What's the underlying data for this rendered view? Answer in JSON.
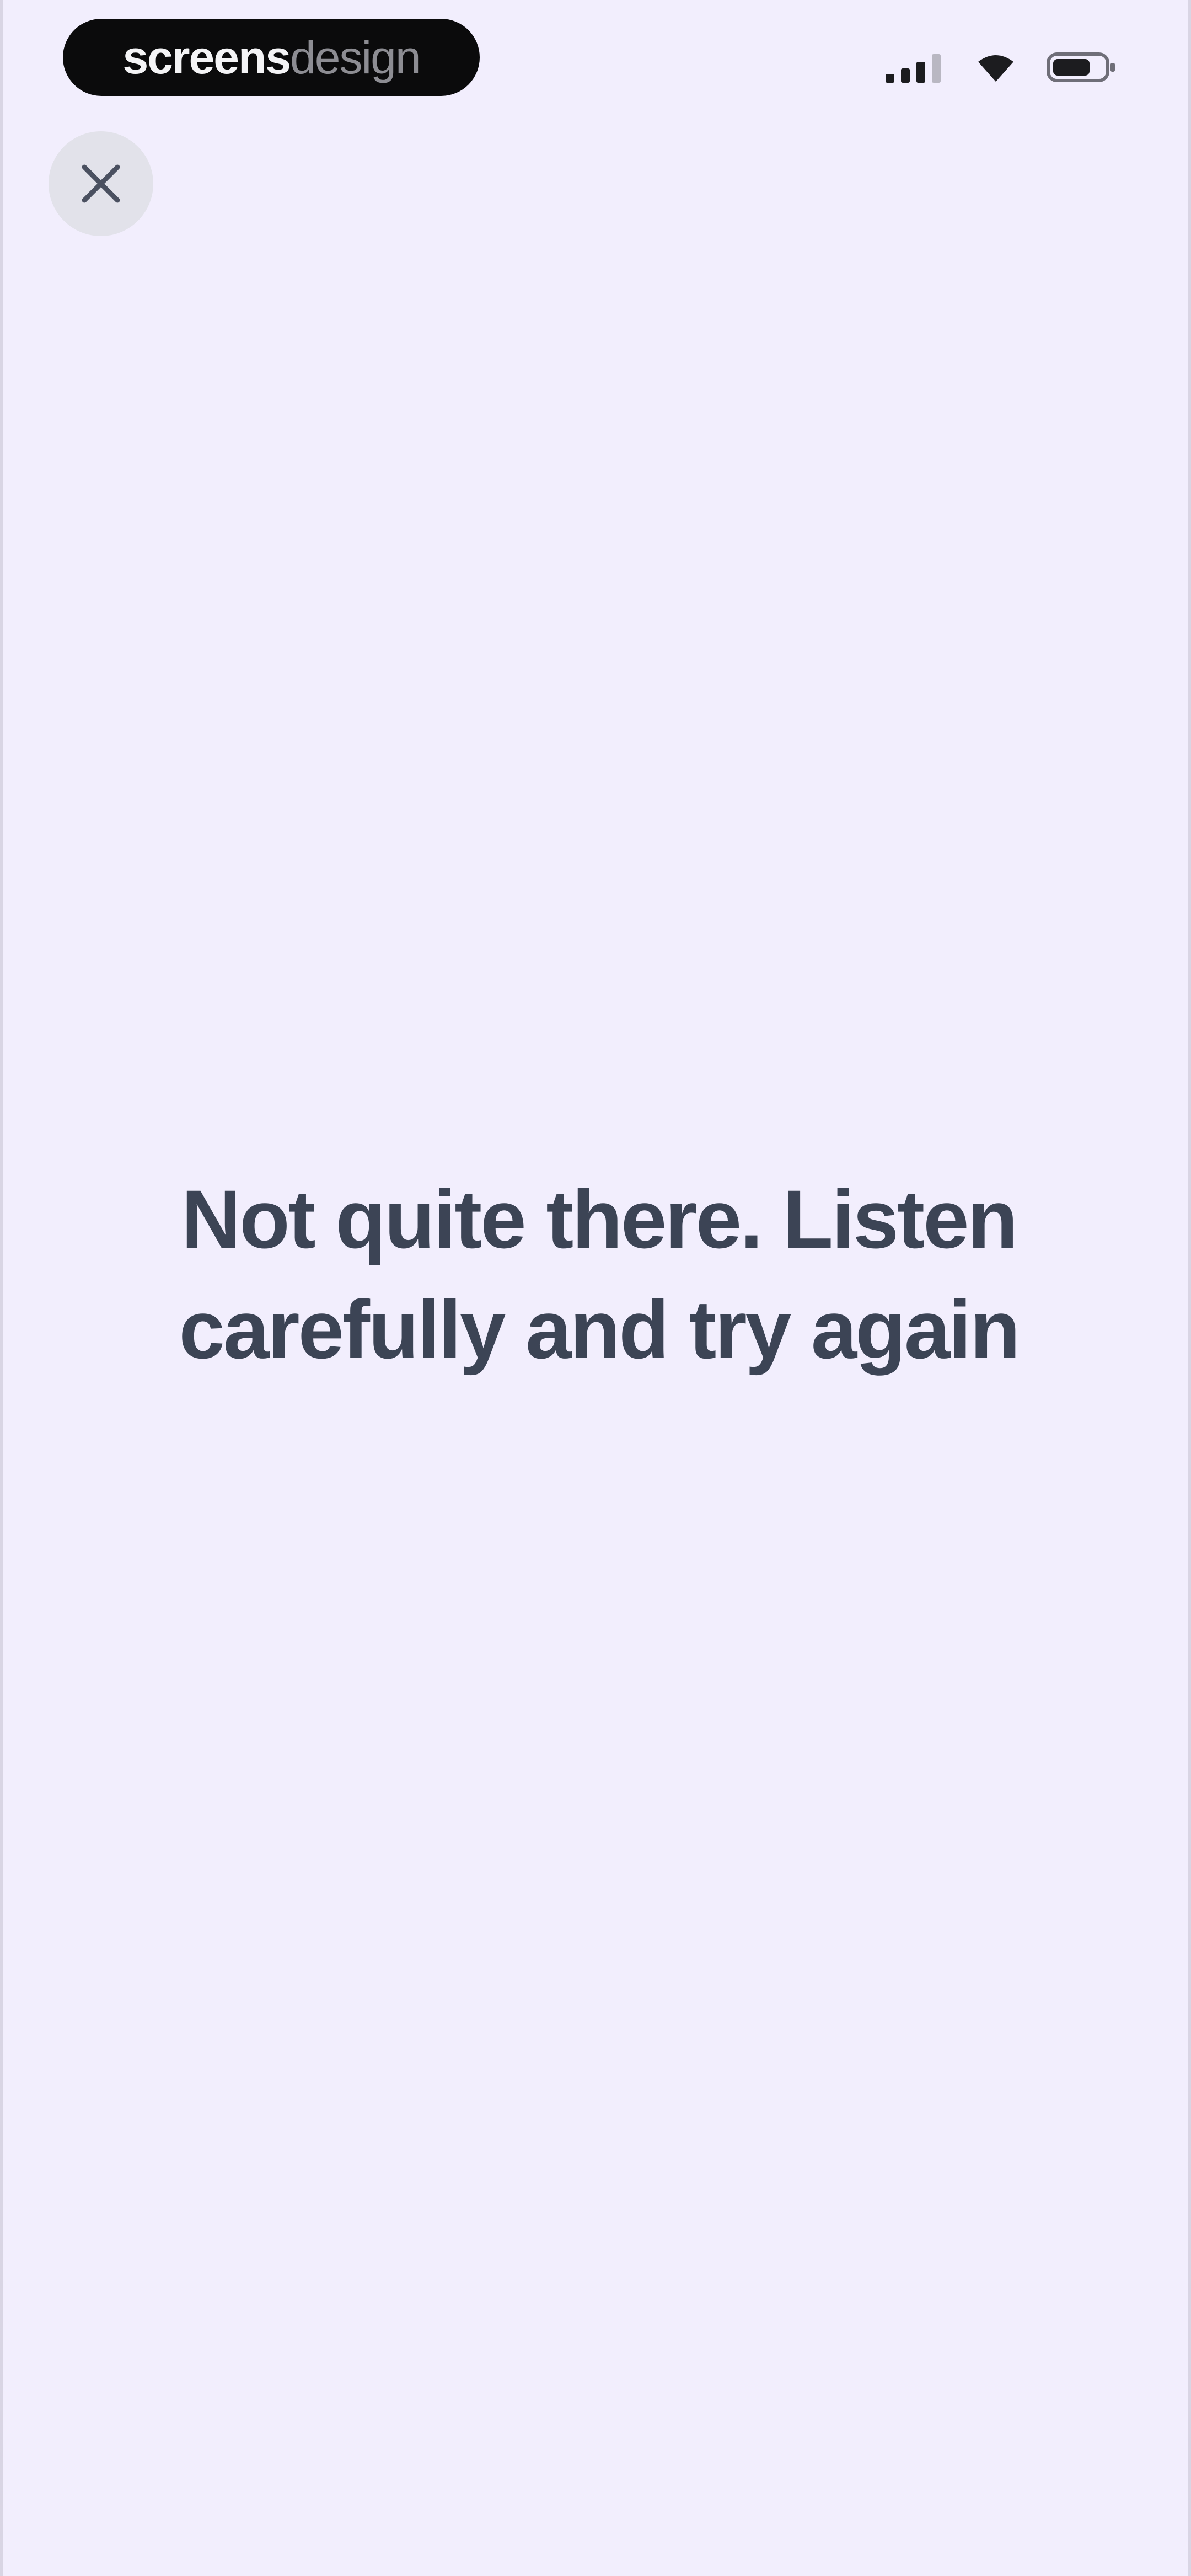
{
  "theme": {
    "background": "#f2eefd",
    "text_color": "#3c4455",
    "close_button_bg": "#e2e2ea"
  },
  "status_bar": {
    "brand_strong": "screens",
    "brand_light": "design",
    "icons": [
      "signal-icon",
      "wifi-icon",
      "battery-icon"
    ]
  },
  "close_button": {
    "icon": "close-icon"
  },
  "message": {
    "line1": "Not quite there. Listen",
    "line2": "carefully and try again"
  }
}
